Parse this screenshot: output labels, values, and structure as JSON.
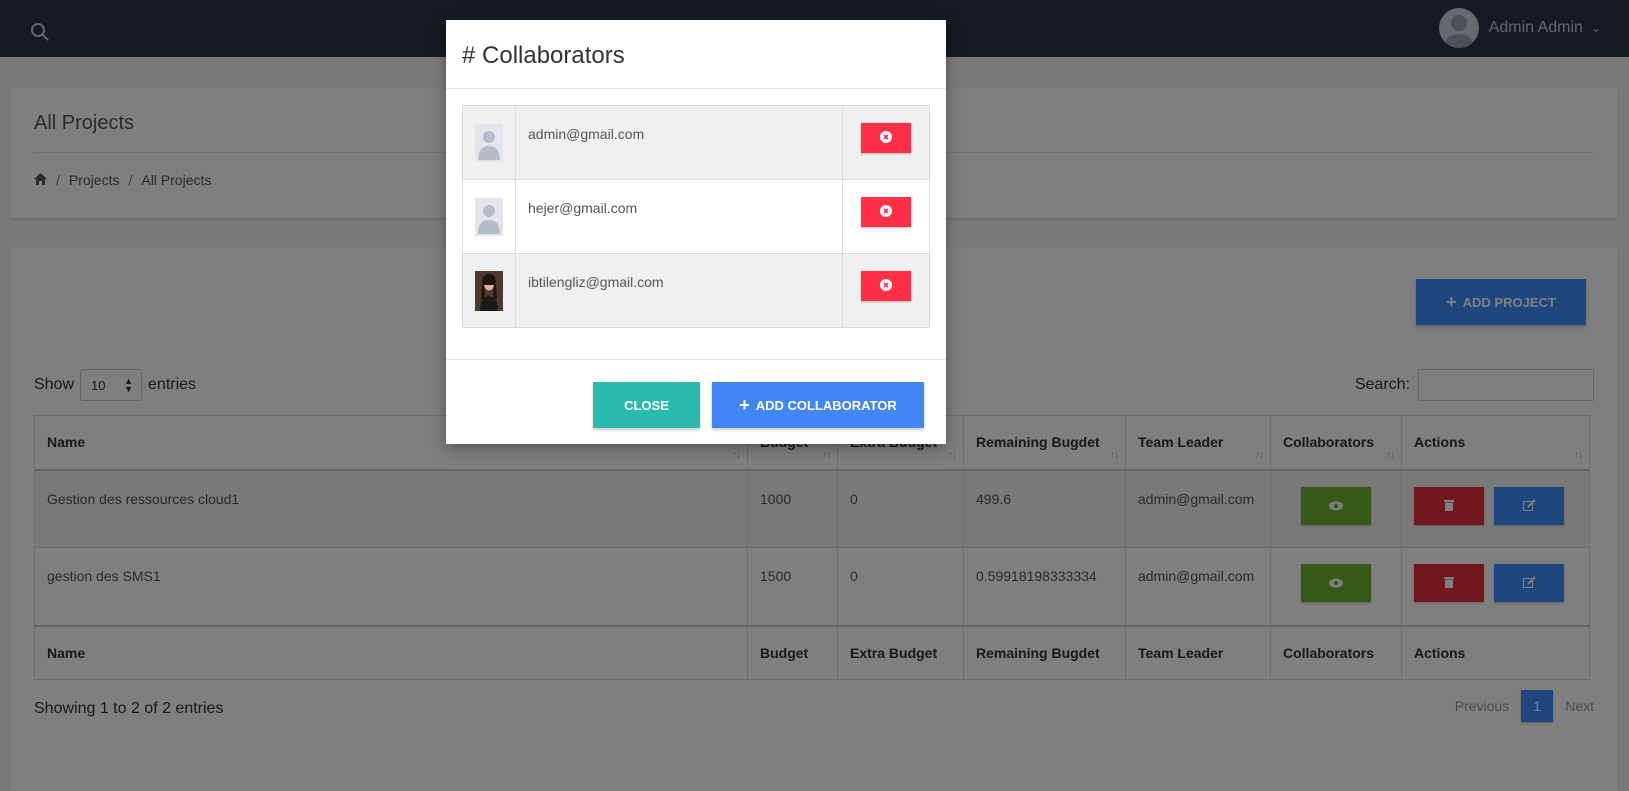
{
  "topbar": {
    "user_name": "Admin Admin"
  },
  "page": {
    "title": "All Projects",
    "breadcrumb": [
      "Projects",
      "All Projects"
    ]
  },
  "toolbar": {
    "add_project_label": "ADD PROJECT",
    "show_label": "Show",
    "entries_value": "10",
    "entries_label": "entries",
    "search_label": "Search:"
  },
  "table": {
    "columns": [
      "Name",
      "Budget",
      "Extra Budget",
      "Remaining Bugdet",
      "Team Leader",
      "Collaborators",
      "Actions"
    ],
    "rows": [
      {
        "name": "Gestion des ressources cloud1",
        "budget": "1000",
        "extra": "0",
        "remaining": "499.6",
        "leader": "admin@gmail.com"
      },
      {
        "name": "gestion des SMS1",
        "budget": "1500",
        "extra": "0",
        "remaining": "0.59918198333334",
        "leader": "admin@gmail.com"
      }
    ],
    "info": "Showing 1 to 2 of 2 entries",
    "pager": {
      "previous": "Previous",
      "page": "1",
      "next": "Next"
    }
  },
  "modal": {
    "title": "# Collaborators",
    "collaborators": [
      {
        "email": "admin@gmail.com",
        "avatar": "placeholder-avatar-icon"
      },
      {
        "email": "hejer@gmail.com",
        "avatar": "placeholder-avatar-icon"
      },
      {
        "email": "ibtilengliz@gmail.com",
        "avatar": "photo-avatar"
      }
    ],
    "close_label": "CLOSE",
    "add_label": "ADD COLLABORATOR"
  },
  "colors": {
    "topbar": "#2a3545",
    "primary": "#3f8efc",
    "success": "#6ab42e",
    "danger": "#e52e3d",
    "teal": "#2bbbad",
    "remove": "#ff2f48"
  }
}
